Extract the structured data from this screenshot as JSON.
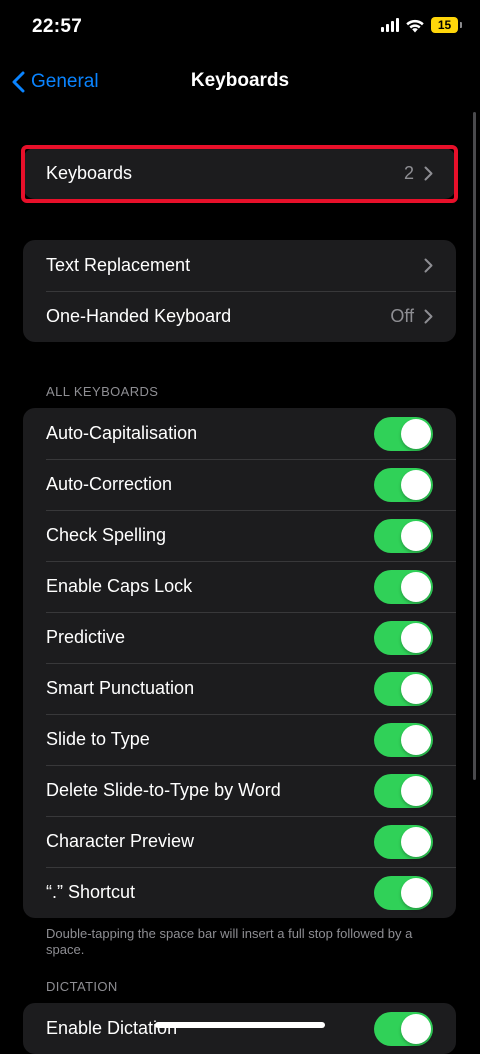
{
  "status_bar": {
    "time": "22:57",
    "battery": "15",
    "icons": [
      "cellular-signal-icon",
      "wifi-icon",
      "battery-icon"
    ]
  },
  "nav": {
    "back_label": "General",
    "title": "Keyboards"
  },
  "colors": {
    "accent": "#0a84ff",
    "toggle_on": "#30d158",
    "highlight": "#e8102a",
    "battery": "#ffd60a"
  },
  "keyboards_row": {
    "label": "Keyboards",
    "value": "2"
  },
  "text_group": {
    "rows": [
      {
        "label": "Text Replacement",
        "value": ""
      },
      {
        "label": "One-Handed Keyboard",
        "value": "Off"
      }
    ]
  },
  "all_keyboards": {
    "header": "ALL KEYBOARDS",
    "rows": [
      {
        "label": "Auto-Capitalisation",
        "on": true
      },
      {
        "label": "Auto-Correction",
        "on": true
      },
      {
        "label": "Check Spelling",
        "on": true
      },
      {
        "label": "Enable Caps Lock",
        "on": true
      },
      {
        "label": "Predictive",
        "on": true
      },
      {
        "label": "Smart Punctuation",
        "on": true
      },
      {
        "label": "Slide to Type",
        "on": true
      },
      {
        "label": "Delete Slide-to-Type by Word",
        "on": true
      },
      {
        "label": "Character Preview",
        "on": true
      },
      {
        "label": "“.” Shortcut",
        "on": true
      }
    ],
    "footer": "Double-tapping the space bar will insert a full stop followed by a space."
  },
  "dictation": {
    "header": "DICTATION",
    "rows": [
      {
        "label": "Enable Dictation",
        "on": true
      }
    ]
  }
}
